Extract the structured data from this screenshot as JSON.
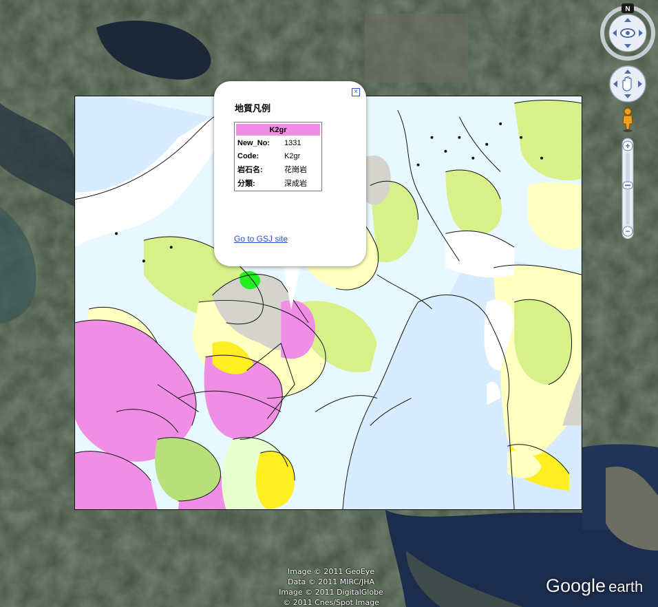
{
  "balloon": {
    "title": "地質凡例",
    "close_glyph": "×",
    "legend_header": "K2gr",
    "rows": [
      {
        "key": "New_No:",
        "value": "1331"
      },
      {
        "key": "Code:",
        "value": "K2gr"
      },
      {
        "key": "岩石名:",
        "value": "花崗岩"
      },
      {
        "key": "分類:",
        "value": "深成岩"
      }
    ],
    "link_text": "Go to GSJ site"
  },
  "navigation": {
    "compass_north": "N",
    "zoom_in": "+",
    "zoom_out": "−",
    "zoom_level": 0.45
  },
  "credits": [
    "Image © 2011 GeoEye",
    "Data © 2011 MIRC/JHA",
    "Image © 2011 DigitalGlobe",
    "© 2011 Cnes/Spot Image"
  ],
  "logo": {
    "google": "Google",
    "earth": "earth"
  },
  "colors": {
    "granite_pink": "#f08ee6",
    "sea": "#d8ecff",
    "pale_yellow": "#ffffc0",
    "light_green": "#d8f08a",
    "yellow": "#ffee22",
    "gray": "#d4d4cc",
    "link": "#2255cc"
  }
}
